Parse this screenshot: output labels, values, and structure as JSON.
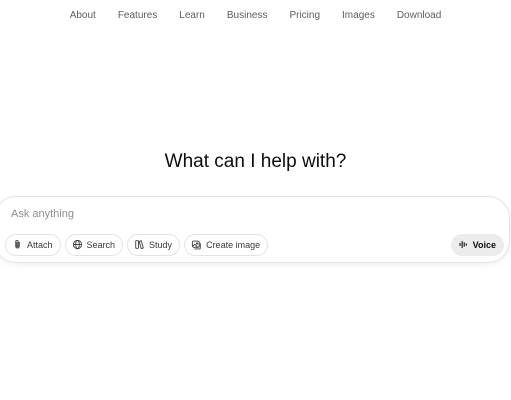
{
  "nav": {
    "items": [
      "About",
      "Features",
      "Learn",
      "Business",
      "Pricing",
      "Images",
      "Download"
    ]
  },
  "main": {
    "headline": "What can I help with?"
  },
  "composer": {
    "placeholder": "Ask anything",
    "tools": [
      {
        "label": "Attach",
        "icon": "paperclip-icon"
      },
      {
        "label": "Search",
        "icon": "globe-icon"
      },
      {
        "label": "Study",
        "icon": "book-icon"
      },
      {
        "label": "Create image",
        "icon": "image-icon"
      }
    ],
    "voice": {
      "label": "Voice",
      "icon": "voice-waveform-icon"
    }
  }
}
